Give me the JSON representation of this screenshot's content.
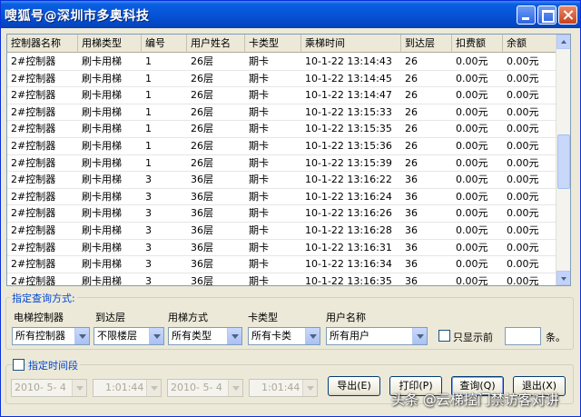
{
  "window": {
    "title": "嗖狐号@深圳市多奥科技"
  },
  "grid": {
    "columns": [
      "控制器名称",
      "用梯类型",
      "编号",
      "用户姓名",
      "卡类型",
      "乘梯时间",
      "到达层",
      "扣费额",
      "余额"
    ],
    "rows": [
      [
        "2#控制器",
        "刷卡用梯",
        "1",
        "26层",
        "期卡",
        "10-1-22 13:14:43",
        "26",
        "0.00元",
        "0.00元"
      ],
      [
        "2#控制器",
        "刷卡用梯",
        "1",
        "26层",
        "期卡",
        "10-1-22 13:14:45",
        "26",
        "0.00元",
        "0.00元"
      ],
      [
        "2#控制器",
        "刷卡用梯",
        "1",
        "26层",
        "期卡",
        "10-1-22 13:14:47",
        "26",
        "0.00元",
        "0.00元"
      ],
      [
        "2#控制器",
        "刷卡用梯",
        "1",
        "26层",
        "期卡",
        "10-1-22 13:15:33",
        "26",
        "0.00元",
        "0.00元"
      ],
      [
        "2#控制器",
        "刷卡用梯",
        "1",
        "26层",
        "期卡",
        "10-1-22 13:15:35",
        "26",
        "0.00元",
        "0.00元"
      ],
      [
        "2#控制器",
        "刷卡用梯",
        "1",
        "26层",
        "期卡",
        "10-1-22 13:15:36",
        "26",
        "0.00元",
        "0.00元"
      ],
      [
        "2#控制器",
        "刷卡用梯",
        "1",
        "26层",
        "期卡",
        "10-1-22 13:15:39",
        "26",
        "0.00元",
        "0.00元"
      ],
      [
        "2#控制器",
        "刷卡用梯",
        "3",
        "36层",
        "期卡",
        "10-1-22 13:16:22",
        "36",
        "0.00元",
        "0.00元"
      ],
      [
        "2#控制器",
        "刷卡用梯",
        "3",
        "36层",
        "期卡",
        "10-1-22 13:16:24",
        "36",
        "0.00元",
        "0.00元"
      ],
      [
        "2#控制器",
        "刷卡用梯",
        "3",
        "36层",
        "期卡",
        "10-1-22 13:16:26",
        "36",
        "0.00元",
        "0.00元"
      ],
      [
        "2#控制器",
        "刷卡用梯",
        "3",
        "36层",
        "期卡",
        "10-1-22 13:16:28",
        "36",
        "0.00元",
        "0.00元"
      ],
      [
        "2#控制器",
        "刷卡用梯",
        "3",
        "36层",
        "期卡",
        "10-1-22 13:16:31",
        "36",
        "0.00元",
        "0.00元"
      ],
      [
        "2#控制器",
        "刷卡用梯",
        "3",
        "36层",
        "期卡",
        "10-1-22 13:16:34",
        "36",
        "0.00元",
        "0.00元"
      ],
      [
        "2#控制器",
        "刷卡用梯",
        "3",
        "36层",
        "期卡",
        "10-1-22 13:16:35",
        "36",
        "0.00元",
        "0.00元"
      ]
    ]
  },
  "query": {
    "legend": "指定查询方式:",
    "controller_label": "电梯控制器",
    "controller_value": "所有控制器",
    "floor_label": "到达层",
    "floor_value": "不限楼层",
    "mode_label": "用梯方式",
    "mode_value": "所有类型",
    "card_label": "卡类型",
    "card_value": "所有卡类",
    "user_label": "用户名称",
    "user_value": "所有用户",
    "show_front_label": "只显示前",
    "records_suffix": "条。"
  },
  "time": {
    "legend": "指定时间段",
    "start_date": "2010- 5- 4",
    "start_time": "1:01:44",
    "end_date": "2010- 5- 4",
    "end_time": "1:01:44"
  },
  "buttons": {
    "export": "导出(E)",
    "print": "打印(P)",
    "query": "查询(Q)",
    "exit": "退出(X)"
  },
  "watermark": "头条 @云梯控门禁访客对讲"
}
